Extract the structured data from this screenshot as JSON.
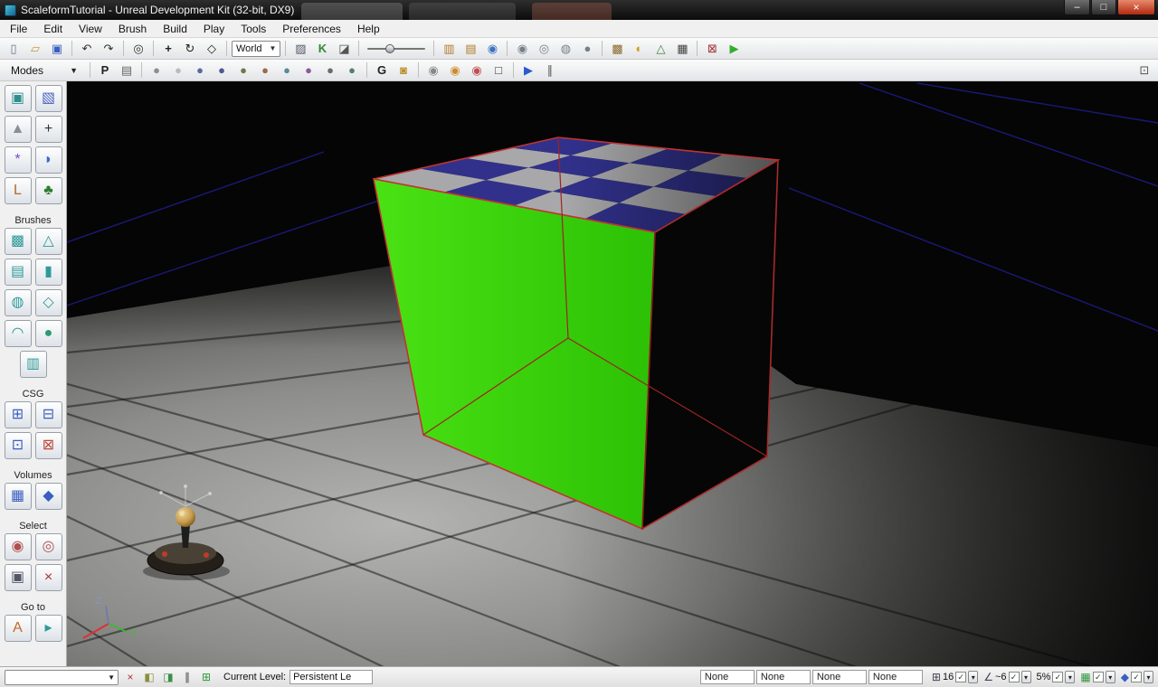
{
  "window": {
    "title": "ScaleformTutorial - Unreal Development Kit (32-bit, DX9)",
    "minimize_glyph": "–",
    "maximize_glyph": "□",
    "close_glyph": "×"
  },
  "menus": [
    "File",
    "Edit",
    "View",
    "Brush",
    "Build",
    "Play",
    "Tools",
    "Preferences",
    "Help"
  ],
  "toolbar_main": {
    "items": [
      {
        "name": "new-level-icon",
        "glyph": "▯",
        "color": "#667788"
      },
      {
        "name": "open-level-icon",
        "glyph": "▱",
        "color": "#c9973b"
      },
      {
        "name": "save-level-icon",
        "glyph": "▣",
        "color": "#3a5fc0"
      },
      {
        "type": "sep"
      },
      {
        "name": "undo-icon",
        "glyph": "↶",
        "color": "#333333"
      },
      {
        "name": "redo-icon",
        "glyph": "↷",
        "color": "#333333"
      },
      {
        "type": "sep"
      },
      {
        "name": "find-actors-icon",
        "glyph": "◎",
        "color": "#333333"
      },
      {
        "type": "sep"
      },
      {
        "name": "translate-widget-icon",
        "glyph": "+",
        "color": "#222222",
        "bold": true
      },
      {
        "name": "rotate-widget-icon",
        "glyph": "↻",
        "color": "#222222"
      },
      {
        "name": "scale-widget-icon",
        "glyph": "◇",
        "color": "#222222"
      },
      {
        "type": "sep"
      },
      {
        "type": "dropdown",
        "name": "coordinate-system-dropdown",
        "label": "World"
      },
      {
        "type": "sep"
      },
      {
        "name": "translucent-selection-icon",
        "glyph": "▨",
        "color": "#555566"
      },
      {
        "name": "kismet-icon",
        "glyph": "K",
        "color": "#2e8b2e",
        "bold": true
      },
      {
        "name": "matinee-icon",
        "glyph": "◪",
        "color": "#555555"
      },
      {
        "type": "sep"
      },
      {
        "type": "slider",
        "name": "camera-speed-slider"
      },
      {
        "type": "sep"
      },
      {
        "name": "content-browser-icon",
        "glyph": "▥",
        "color": "#b07a2a"
      },
      {
        "name": "actor-classes-icon",
        "glyph": "▤",
        "color": "#b07a2a"
      },
      {
        "name": "world-properties-icon",
        "glyph": "◉",
        "color": "#3a72c0"
      },
      {
        "type": "sep"
      },
      {
        "name": "camera-perspective-icon",
        "glyph": "◉",
        "color": "#76808a"
      },
      {
        "name": "camera-top-icon",
        "glyph": "◎",
        "color": "#76808a"
      },
      {
        "name": "camera-front-icon",
        "glyph": "◍",
        "color": "#76808a"
      },
      {
        "name": "camera-side-icon",
        "glyph": "●",
        "color": "#76808a"
      },
      {
        "type": "sep"
      },
      {
        "name": "build-geometry-icon",
        "glyph": "▩",
        "color": "#8a6a2a"
      },
      {
        "name": "build-lighting-icon",
        "glyph": "◐",
        "color": "#d09a20"
      },
      {
        "name": "build-paths-icon",
        "glyph": "△",
        "color": "#3a8a3a"
      },
      {
        "name": "build-all-icon",
        "glyph": "▦",
        "color": "#444444"
      },
      {
        "type": "sep"
      },
      {
        "name": "unreal-frontend-icon",
        "glyph": "⊠",
        "color": "#a03030"
      },
      {
        "name": "play-in-editor-icon",
        "glyph": "▶",
        "color": "#2fae2f"
      }
    ]
  },
  "toolbar_viewport": {
    "modes_label": "Modes",
    "items": [
      {
        "name": "publish-icon",
        "glyph": "P",
        "color": "#222222",
        "bold": true
      },
      {
        "name": "viewport-layout-icon",
        "glyph": "▤",
        "color": "#666666"
      },
      {
        "type": "sep"
      },
      {
        "name": "viewmode-brush-wireframe-icon",
        "glyph": "●",
        "color": "#8a8f96"
      },
      {
        "name": "viewmode-wireframe-icon",
        "glyph": "●",
        "color": "#b7bcc2"
      },
      {
        "name": "viewmode-unlit-icon",
        "glyph": "●",
        "color": "#5a6aa0"
      },
      {
        "name": "viewmode-lit-icon",
        "glyph": "●",
        "color": "#4a5a90"
      },
      {
        "name": "viewmode-detail-lighting-icon",
        "glyph": "●",
        "color": "#6a7a50"
      },
      {
        "name": "viewmode-lighting-only-icon",
        "glyph": "●",
        "color": "#9a6a4a"
      },
      {
        "name": "viewmode-light-complexity-icon",
        "glyph": "●",
        "color": "#5a8a9a"
      },
      {
        "name": "viewmode-texture-density-icon",
        "glyph": "●",
        "color": "#8a5a9a"
      },
      {
        "name": "viewmode-shader-complexity-icon",
        "glyph": "●",
        "color": "#6a6a6a"
      },
      {
        "name": "viewmode-lightmap-density-icon",
        "glyph": "●",
        "color": "#50806a"
      },
      {
        "type": "sep"
      },
      {
        "name": "game-view-icon",
        "glyph": "G",
        "color": "#222222",
        "bold": true
      },
      {
        "name": "lock-viewport-icon",
        "glyph": "◙",
        "color": "#b8912a"
      },
      {
        "type": "sep"
      },
      {
        "name": "camera-speed-icon",
        "glyph": "◉",
        "color": "#888888"
      },
      {
        "name": "screenshot-icon",
        "glyph": "◉",
        "color": "#d08a2a"
      },
      {
        "name": "record-camera-icon",
        "glyph": "◉",
        "color": "#c05050"
      },
      {
        "name": "brush-polys-icon",
        "glyph": "□",
        "color": "#333333"
      },
      {
        "type": "sep"
      },
      {
        "name": "realtime-preview-icon",
        "glyph": "▶",
        "color": "#2a5ad0"
      },
      {
        "name": "viewport-splitter-icon",
        "glyph": "∥",
        "color": "#555555"
      },
      {
        "name": "dock-toolbar-icon",
        "glyph": "⊡",
        "color": "#555555",
        "right": true
      }
    ]
  },
  "sidebar": {
    "sections": [
      {
        "label": "",
        "items": [
          {
            "name": "camera-mode-icon",
            "glyph": "▣",
            "color": "#2f8f8f"
          },
          {
            "name": "geometry-mode-icon",
            "glyph": "▧",
            "color": "#4a66c0"
          },
          {
            "name": "terrain-mode-icon",
            "glyph": "▲",
            "color": "#8a8f96"
          },
          {
            "name": "texture-align-mode-icon",
            "glyph": "+",
            "color": "#333333"
          },
          {
            "name": "spline-mode-icon",
            "glyph": "*",
            "color": "#7a4ad0"
          },
          {
            "name": "mesh-paint-mode-icon",
            "glyph": "◗",
            "color": "#3a6ad0"
          },
          {
            "name": "landscape-mode-icon",
            "glyph": "L",
            "color": "#b06a2a"
          },
          {
            "name": "foliage-mode-icon",
            "glyph": "♣",
            "color": "#2e7d32"
          }
        ]
      },
      {
        "label": "Brushes",
        "items": [
          {
            "name": "builder-cube-icon",
            "glyph": "▩",
            "color": "#2f9a9a"
          },
          {
            "name": "builder-cone-icon",
            "glyph": "△",
            "color": "#2f9a9a"
          },
          {
            "name": "builder-stairs-icon",
            "glyph": "▤",
            "color": "#2f9a9a"
          },
          {
            "name": "builder-cylinder-icon",
            "glyph": "▮",
            "color": "#2f9a9a"
          },
          {
            "name": "builder-spiral-stairs-icon",
            "glyph": "◍",
            "color": "#2f9a9a"
          },
          {
            "name": "builder-sheet-icon",
            "glyph": "◇",
            "color": "#2f9a9a"
          },
          {
            "name": "builder-curved-stairs-icon",
            "glyph": "◠",
            "color": "#2f9a9a"
          },
          {
            "name": "builder-sphere-icon",
            "glyph": "●",
            "color": "#2f9a70"
          },
          {
            "name": "builder-volumetric-icon",
            "glyph": "▥",
            "color": "#2f9a9a"
          }
        ]
      },
      {
        "label": "CSG",
        "items": [
          {
            "name": "csg-add-icon",
            "glyph": "⊞",
            "color": "#3a5fc0"
          },
          {
            "name": "csg-subtract-icon",
            "glyph": "⊟",
            "color": "#3a5fc0"
          },
          {
            "name": "csg-intersect-icon",
            "glyph": "⊡",
            "color": "#3a5fc0"
          },
          {
            "name": "csg-deintersect-icon",
            "glyph": "⊠",
            "color": "#c04a3a"
          }
        ]
      },
      {
        "label": "Volumes",
        "items": [
          {
            "name": "add-volume-icon",
            "glyph": "▦",
            "color": "#3a5fc0"
          },
          {
            "name": "volume-list-icon",
            "glyph": "◆",
            "color": "#3a5fc0"
          }
        ]
      },
      {
        "label": "Select",
        "items": [
          {
            "name": "select-matching-brush-icon",
            "glyph": "◉",
            "color": "#b05050"
          },
          {
            "name": "select-matching-texture-icon",
            "glyph": "◎",
            "color": "#b05050"
          },
          {
            "name": "select-all-icon",
            "glyph": "▣",
            "color": "#555566"
          },
          {
            "name": "deselect-all-icon",
            "glyph": "×",
            "color": "#b03030"
          }
        ]
      },
      {
        "label": "Go to",
        "items": [
          {
            "name": "goto-actor-icon",
            "glyph": "A",
            "color": "#c06a2a"
          },
          {
            "name": "goto-builder-brush-icon",
            "glyph": "▸",
            "color": "#2f9a9a"
          }
        ]
      }
    ]
  },
  "viewport": {
    "axis_y": "Y",
    "axis_z": "Z"
  },
  "scene": {
    "checker": {
      "cols": 4,
      "rows": 4,
      "gray": "#a8a8aa",
      "blue": "#31318c"
    },
    "green_face": "#3bd60c",
    "wire_red": "#c03434",
    "grid_blue": "#1d1d8f"
  },
  "statusbar": {
    "left_icons": [
      {
        "name": "selection-lock-icon",
        "glyph": "×",
        "color": "#b23535"
      },
      {
        "name": "camera-left-icon",
        "glyph": "◧",
        "color": "#8a8f3a"
      },
      {
        "name": "camera-right-icon",
        "glyph": "◨",
        "color": "#3a8f4a"
      },
      {
        "name": "splitter-icon",
        "glyph": "∥",
        "color": "#444444"
      },
      {
        "name": "grid-visibility-icon",
        "glyph": "⊞",
        "color": "#2f9a3f"
      }
    ],
    "level_label": "Current Level:",
    "level_value": "Persistent Le",
    "none_fields": [
      "None",
      "None",
      "None",
      "None"
    ],
    "snap_groups": [
      {
        "name": "drag-grid",
        "icon": "⊞",
        "icon_name": "drag-grid-icon",
        "icon_color": "#444455",
        "value": "16"
      },
      {
        "name": "rotation-grid",
        "icon": "∠",
        "icon_name": "rotation-grid-icon",
        "icon_color": "#444455",
        "value": "~6"
      },
      {
        "name": "scale-grid",
        "value": "5%"
      },
      {
        "name": "autosave",
        "icon": "▦",
        "icon_name": "autosave-icon",
        "icon_color": "#2f9a3f"
      },
      {
        "name": "camera-align",
        "icon": "◆",
        "icon_name": "camera-align-icon",
        "icon_color": "#3a5fc0"
      }
    ]
  }
}
